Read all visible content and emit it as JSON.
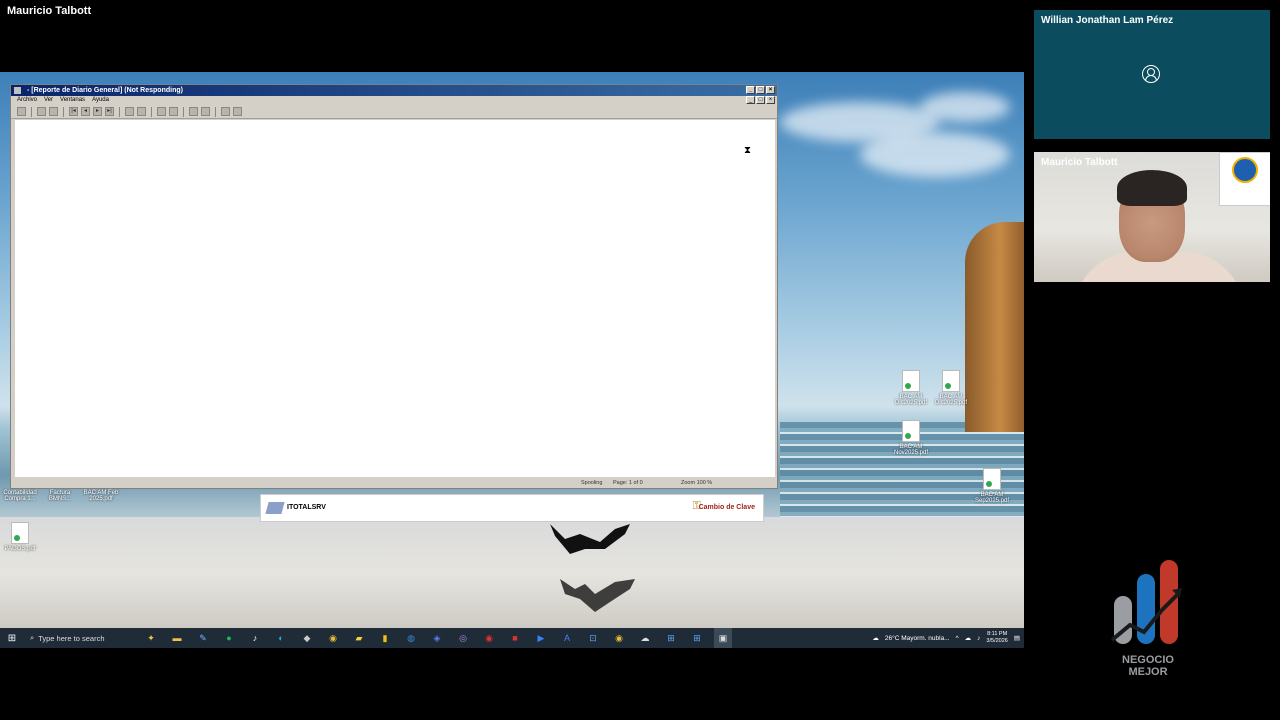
{
  "meeting": {
    "presenter_name": "Mauricio Talbott",
    "participants": [
      {
        "name": "Willian Jonathan Lam Pérez",
        "video": false
      },
      {
        "name": "Mauricio Talbott",
        "video": true
      }
    ]
  },
  "app_window": {
    "title": "- [Reporte de Diario General] (Not Responding)",
    "menu": [
      "Archivo",
      "Ver",
      "Ventanas",
      "Ayuda"
    ],
    "status": {
      "spooling": "Spooling",
      "page": "Page: 1 of 0",
      "zoom": "Zoom 100 %"
    }
  },
  "citrix_bar": {
    "server": "ITOTALSRV",
    "change_password": "Cambio de Clave"
  },
  "desktop_icons": [
    {
      "label": "BAC AM Dic2025.pdf"
    },
    {
      "label": "BAC AM Dic2025.pdf"
    },
    {
      "label": "BAC AM Nov2025.pdf"
    },
    {
      "label": "BAC AM Sep2025.pdf"
    },
    {
      "label": "Contabilidad Compra 1..."
    },
    {
      "label": "Factura BMNS..."
    },
    {
      "label": "BAC AM Feb 2025.pdf"
    },
    {
      "label": "PAGOS.pdf"
    }
  ],
  "taskbar": {
    "search_placeholder": "Type here to search",
    "weather": "26°C  Mayorm. nubla...",
    "time": "8:11 PM",
    "date": "3/5/2026"
  },
  "brand": {
    "line1": "NEGOCIO",
    "line2": "MEJOR",
    "colors": [
      "#9a9ea2",
      "#1e73be",
      "#c0392b"
    ]
  }
}
